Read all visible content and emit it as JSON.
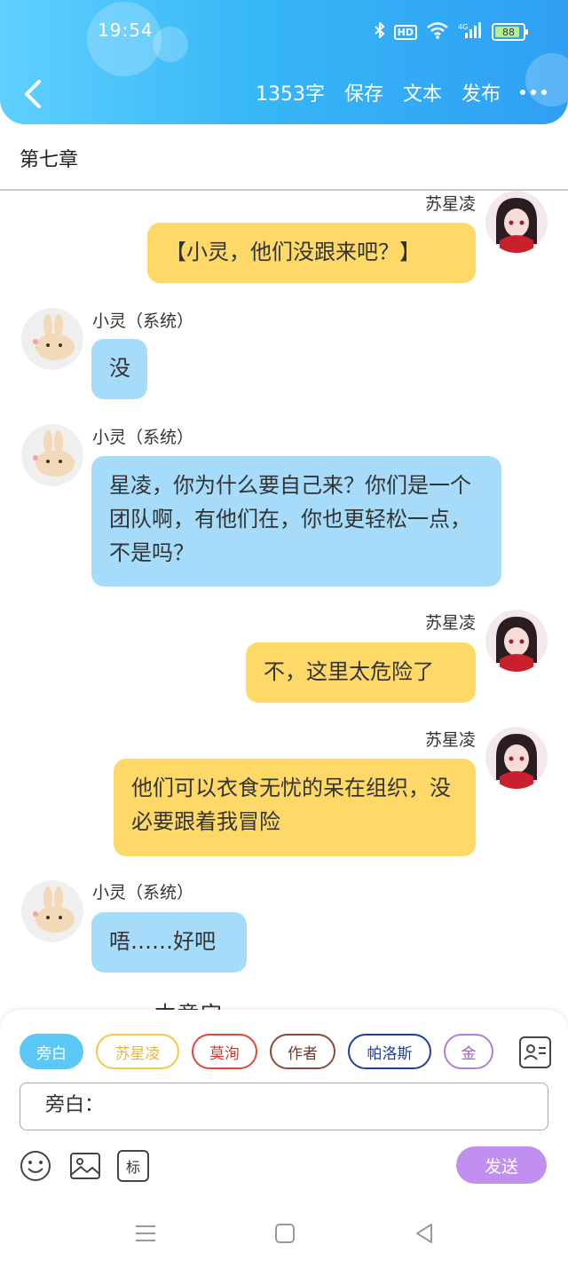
{
  "status_bar": {
    "time": "19:54",
    "battery": "88",
    "hd": "HD",
    "network": "4G"
  },
  "toolbar": {
    "word_count": "1353字",
    "save": "保存",
    "text": "文本",
    "publish": "发布"
  },
  "chapter": {
    "title": "第七章"
  },
  "messages": [
    {
      "speaker": "苏星凌",
      "side": "right",
      "text": "【小灵，他们没跟来吧？】"
    },
    {
      "speaker": "小灵（系统）",
      "side": "left",
      "text": "没"
    },
    {
      "speaker": "小灵（系统）",
      "side": "left",
      "text": "星凌，你为什么要自己来？你们是一个团队啊，有他们在，你也更轻松一点，不是吗？"
    },
    {
      "speaker": "苏星凌",
      "side": "right",
      "text": "不，这里太危险了"
    },
    {
      "speaker": "苏星凌",
      "side": "right",
      "text": "他们可以衣食无忧的呆在组织，没必要跟着我冒险"
    },
    {
      "speaker": "小灵（系统）",
      "side": "left",
      "text": "唔……好吧"
    }
  ],
  "chapter_end": "————本章完————",
  "roles": [
    {
      "label": "旁白",
      "color": "#5bc8f5",
      "active": true
    },
    {
      "label": "苏星凌",
      "color": "#f3c94a",
      "active": false
    },
    {
      "label": "莫洵",
      "color": "#e0463a",
      "active": false
    },
    {
      "label": "作者",
      "color": "#8a4a3a",
      "active": false
    },
    {
      "label": "帕洛斯",
      "color": "#1f3f9a",
      "active": false
    },
    {
      "label": "金",
      "color": "#b67ad9",
      "active": false
    }
  ],
  "input": {
    "value": "旁白："
  },
  "send_label": "发送",
  "tool_labels": {
    "mark": "标"
  },
  "icons": {
    "back": "chevron-left-icon",
    "more": "more-icon",
    "emoji": "smile-icon",
    "image": "image-icon",
    "contacts": "contacts-icon"
  }
}
